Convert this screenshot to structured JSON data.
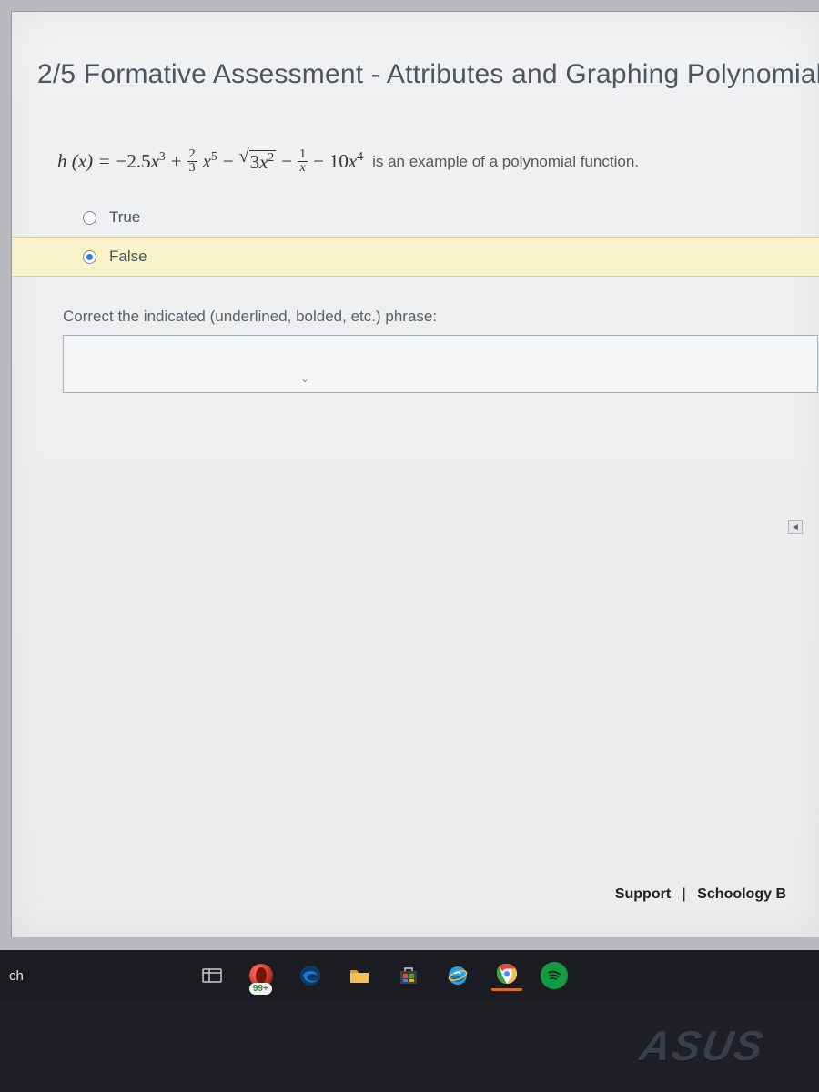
{
  "page_title": "2/5 Formative Assessment - Attributes and Graphing Polynomial",
  "equation": {
    "lhs_func": "h",
    "lhs_arg": "x",
    "coef1": "−2.5",
    "pow1": "3",
    "frac2_num": "2",
    "frac2_den": "3",
    "pow2": "5",
    "sqrt_coef": "3",
    "sqrt_pow": "2",
    "frac4_num": "1",
    "frac4_den": "x",
    "coef5": "10",
    "pow5": "4",
    "tail": "is an example of a polynomial function."
  },
  "options": {
    "true": {
      "label": "True",
      "selected": false
    },
    "false": {
      "label": "False",
      "selected": true
    }
  },
  "correction_label": "Correct the indicated (underlined, bolded, etc.) phrase:",
  "correction_value": "",
  "footer": {
    "support": "Support",
    "schoology": "Schoology B"
  },
  "taskbar": {
    "search_truncated": "ch",
    "opera_badge": "99+"
  },
  "brand": "ASUS"
}
